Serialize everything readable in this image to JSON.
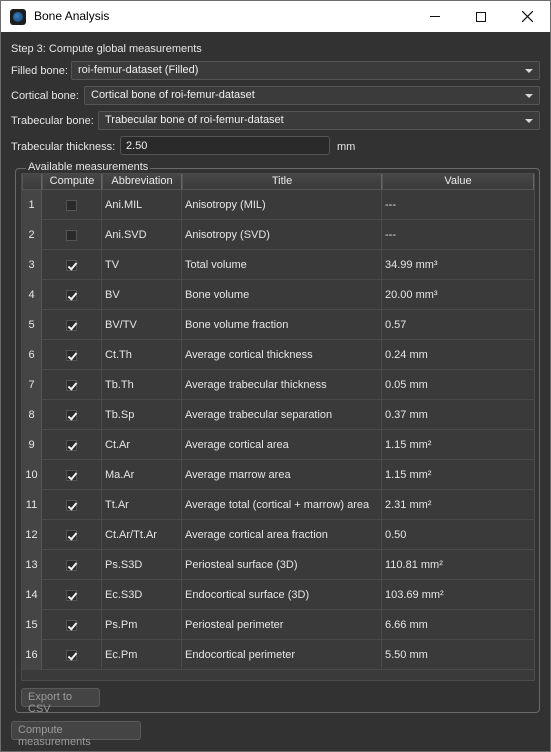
{
  "window": {
    "title": "Bone Analysis"
  },
  "form": {
    "step_label": "Step 3: Compute global measurements",
    "filled_bone_label": "Filled bone:",
    "filled_bone_value": "roi-femur-dataset (Filled)",
    "cortical_bone_label": "Cortical bone:",
    "cortical_bone_value": "Cortical bone of roi-femur-dataset",
    "trabecular_bone_label": "Trabecular bone:",
    "trabecular_bone_value": "Trabecular bone of roi-femur-dataset",
    "thickness_label": "Trabecular thickness:",
    "thickness_value": "2.50",
    "thickness_unit": "mm"
  },
  "table": {
    "group_title": "Available measurements",
    "headers": {
      "compute": "Compute",
      "abbreviation": "Abbreviation",
      "title": "Title",
      "value": "Value"
    },
    "rows": [
      {
        "num": "1",
        "checked": false,
        "abbr": "Ani.MIL",
        "title": "Anisotropy (MIL)",
        "value": "---"
      },
      {
        "num": "2",
        "checked": false,
        "abbr": "Ani.SVD",
        "title": "Anisotropy (SVD)",
        "value": "---"
      },
      {
        "num": "3",
        "checked": true,
        "abbr": "TV",
        "title": "Total volume",
        "value": "34.99 mm³"
      },
      {
        "num": "4",
        "checked": true,
        "abbr": "BV",
        "title": "Bone volume",
        "value": "20.00 mm³"
      },
      {
        "num": "5",
        "checked": true,
        "abbr": "BV/TV",
        "title": "Bone volume fraction",
        "value": "0.57"
      },
      {
        "num": "6",
        "checked": true,
        "abbr": "Ct.Th",
        "title": "Average cortical thickness",
        "value": "0.24 mm"
      },
      {
        "num": "7",
        "checked": true,
        "abbr": "Tb.Th",
        "title": "Average trabecular thickness",
        "value": "0.05 mm"
      },
      {
        "num": "8",
        "checked": true,
        "abbr": "Tb.Sp",
        "title": "Average trabecular separation",
        "value": "0.37 mm"
      },
      {
        "num": "9",
        "checked": true,
        "abbr": "Ct.Ar",
        "title": "Average cortical area",
        "value": "1.15 mm²"
      },
      {
        "num": "10",
        "checked": true,
        "abbr": "Ma.Ar",
        "title": "Average marrow area",
        "value": "1.15 mm²"
      },
      {
        "num": "11",
        "checked": true,
        "abbr": "Tt.Ar",
        "title": "Average total (cortical + marrow) area",
        "value": "2.31 mm²"
      },
      {
        "num": "12",
        "checked": true,
        "abbr": "Ct.Ar/Tt.Ar",
        "title": "Average cortical area fraction",
        "value": "0.50"
      },
      {
        "num": "13",
        "checked": true,
        "abbr": "Ps.S3D",
        "title": "Periosteal surface (3D)",
        "value": "110.81 mm²"
      },
      {
        "num": "14",
        "checked": true,
        "abbr": "Ec.S3D",
        "title": "Endocortical surface (3D)",
        "value": "103.69 mm²"
      },
      {
        "num": "15",
        "checked": true,
        "abbr": "Ps.Pm",
        "title": "Periosteal perimeter",
        "value": "6.66 mm"
      },
      {
        "num": "16",
        "checked": true,
        "abbr": "Ec.Pm",
        "title": "Endocortical perimeter",
        "value": "5.50 mm"
      }
    ]
  },
  "buttons": {
    "export_label": "Export to CSV",
    "compute_label": "Compute measurements"
  }
}
